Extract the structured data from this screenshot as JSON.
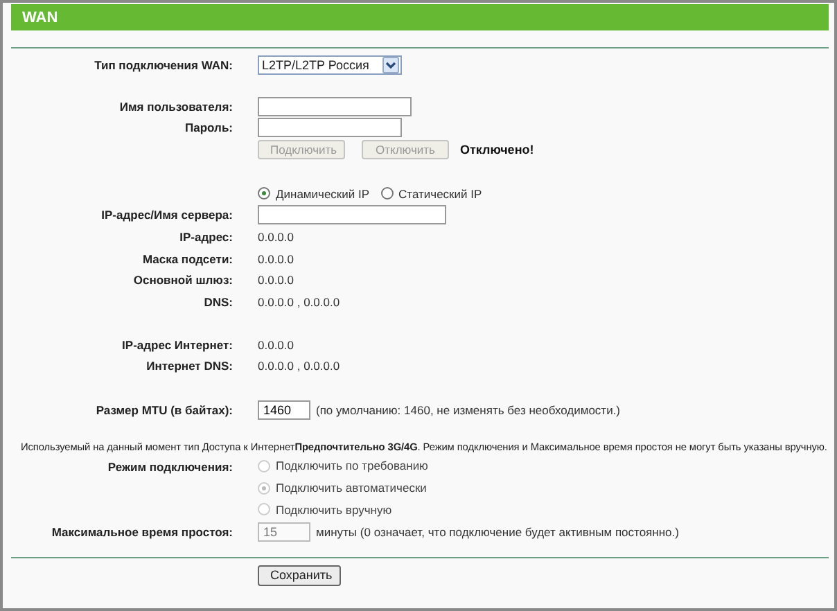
{
  "header": {
    "title": "WAN"
  },
  "wan_type": {
    "label": "Тип подключения WAN:",
    "value": "L2TP/L2TP Россия"
  },
  "username": {
    "label": "Имя пользователя:"
  },
  "password": {
    "label": "Пароль:"
  },
  "connect_buttons": [
    {
      "label": "Подключить",
      "disabled": true
    },
    {
      "label": "Отключить",
      "disabled": true
    }
  ],
  "status": "Отключено!",
  "ip_mode": [
    {
      "label": "Динамический IP",
      "selected": true
    },
    {
      "label": "Статический IP",
      "selected": false
    }
  ],
  "server": {
    "label": "IP-адрес/Имя сервера:"
  },
  "info": [
    {
      "label": "IP-адрес:",
      "value": "0.0.0.0"
    },
    {
      "label": "Маска подсети:",
      "value": "0.0.0.0"
    },
    {
      "label": "Основной шлюз:",
      "value": "0.0.0.0"
    },
    {
      "label": "DNS:",
      "value": "0.0.0.0 , 0.0.0.0"
    }
  ],
  "internet_info": [
    {
      "label": "IP-адрес Интернет:",
      "value": "0.0.0.0"
    },
    {
      "label": "Интернет DNS:",
      "value": "0.0.0.0 , 0.0.0.0"
    }
  ],
  "mtu": {
    "label": "Размер MTU (в байтах):",
    "value": "1460",
    "hint": "(по умолчанию: 1460, не изменять без необходимости.)"
  },
  "notice": "Используемый на данный момент тип Доступа к Интернет**Предпочтительно 3G/4G**. Режим подключения и Максимальное время простоя не могут быть указаны вручную.",
  "connection_mode": {
    "label": "Режим подключения:",
    "disabled": true,
    "options": [
      {
        "label": "Подключить по требованию",
        "selected": false
      },
      {
        "label": "Подключить автоматически",
        "selected": true
      },
      {
        "label": "Подключить вручную",
        "selected": false
      }
    ]
  },
  "idle_time": {
    "label": "Максимальное время простоя:",
    "value": "15",
    "disabled": true,
    "unit": "минуты (0 означает, что подключение будет активным постоянно.)"
  },
  "save_button": {
    "label": "Сохранить"
  }
}
